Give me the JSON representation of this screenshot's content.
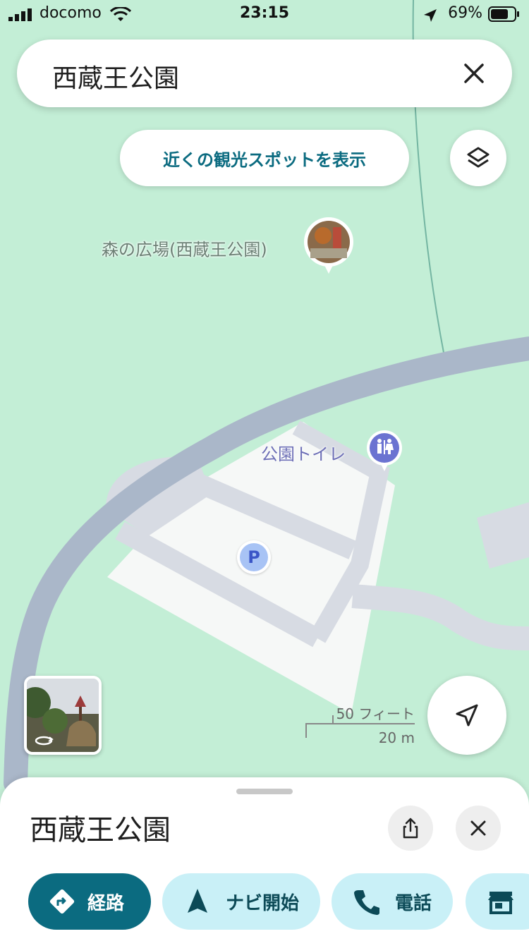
{
  "status_bar": {
    "carrier": "docomo",
    "time": "23:15",
    "battery": "69%"
  },
  "search": {
    "query": "西蔵王公園"
  },
  "nearby_chip": {
    "label": "近くの観光スポットを表示"
  },
  "map": {
    "poi_forest_plaza": "森の広場(西蔵王公園)",
    "poi_toilet": "公園トイレ",
    "parking_symbol": "P",
    "scale_feet": "50 フィート",
    "scale_meters": "20 m"
  },
  "sheet": {
    "title": "西蔵王公園",
    "actions": [
      {
        "label": "経路",
        "icon": "directions-icon"
      },
      {
        "label": "ナビ開始",
        "icon": "navigation-arrow-icon"
      },
      {
        "label": "電話",
        "icon": "phone-icon"
      },
      {
        "label": "",
        "icon": "store-icon"
      }
    ]
  },
  "colors": {
    "map_green": "#c3eed6",
    "road": "#aab7c9",
    "accent": "#0b6b80",
    "chip_light": "#c9f0f7"
  }
}
